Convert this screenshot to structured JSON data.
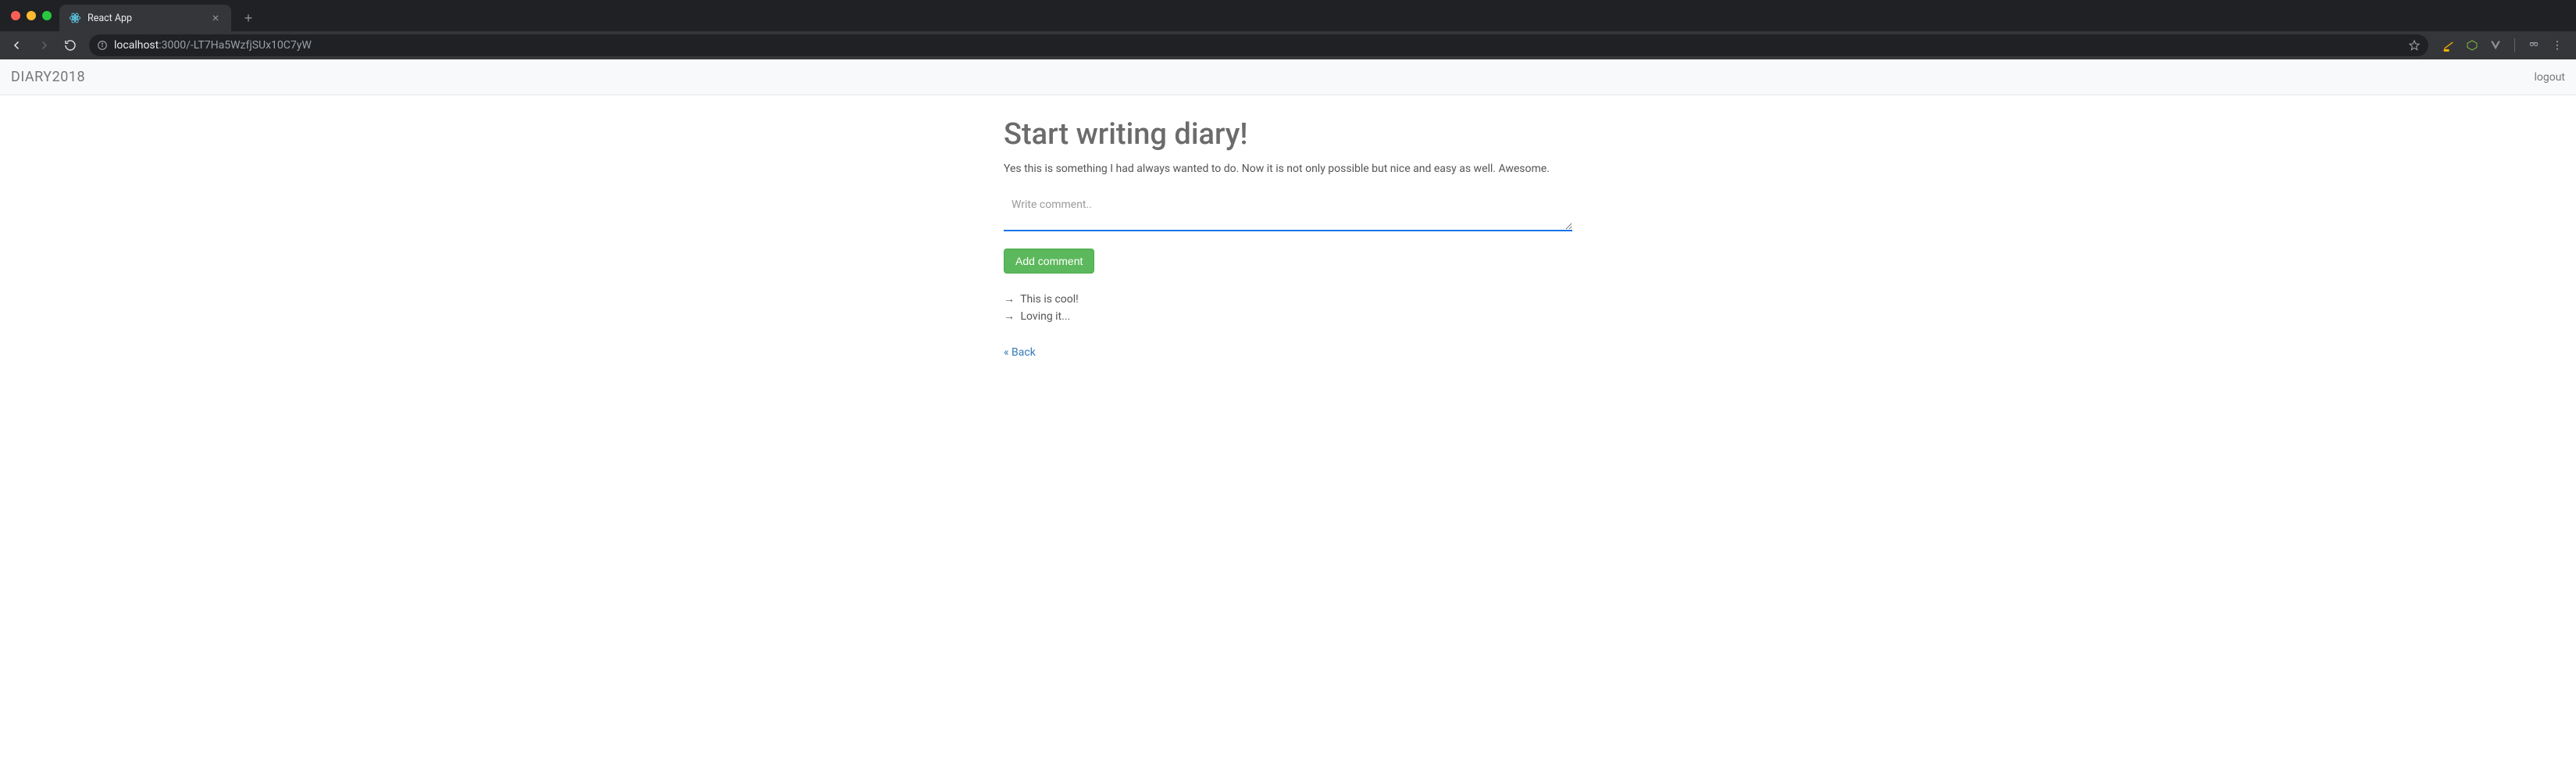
{
  "browser": {
    "tab_title": "React App",
    "url_prefix": "localhost",
    "url_port_path": ":3000/-LT7Ha5WzfjSUx10C7yW"
  },
  "header": {
    "brand": "DIARY2018",
    "logout_label": "logout"
  },
  "main": {
    "title": "Start writing diary!",
    "description": "Yes this is something I had always wanted to do. Now it is not only possible but nice and easy as well. Awesome.",
    "comment_placeholder": "Write comment..",
    "add_comment_label": "Add comment",
    "comments": [
      {
        "text": "This is cool!"
      },
      {
        "text": "Loving it..."
      }
    ],
    "back_label": "« Back"
  }
}
